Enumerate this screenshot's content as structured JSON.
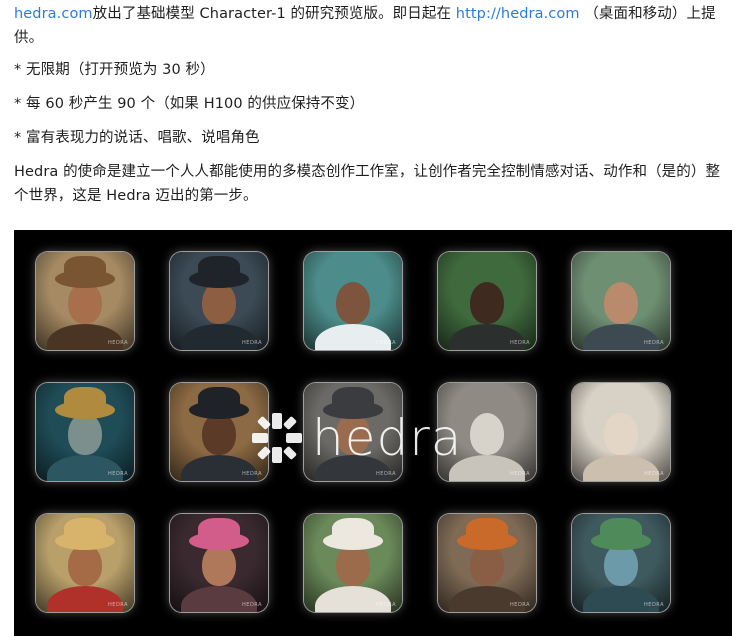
{
  "article": {
    "p1": {
      "link1": "hedra.com",
      "text1": "放出了基础模型 Character-1 的研究预览版。即日起在 ",
      "link2": "http://hedra.com",
      "text2": " （桌面和移动）上提供。"
    },
    "bullets": [
      "* 无限期（打开预览为 30 秒）",
      "* 每 60 秒产生 90 个（如果 H100 的供应保持不变）",
      "* 富有表现力的说话、唱歌、说唱角色"
    ],
    "p2": "Hedra 的使命是建立一个人人都能使用的多模态创作工作室，让创作者完全控制情感对话、动作和（是的）整个世界，这是 Hedra 迈出的第一步。"
  },
  "media": {
    "logo_text": "hedra",
    "tile_tag": "HEDRA",
    "tiles": [
      {
        "name": "cowboy-portrait",
        "bg": "#a58a63",
        "skin": "#a86f4c",
        "cloth": "#4a3424",
        "hat": true,
        "hatColor": "#7a5534"
      },
      {
        "name": "cap-man-portrait",
        "bg": "#3b4a55",
        "skin": "#8d5e42",
        "cloth": "#222a31",
        "hat": true,
        "hatColor": "#1e2429"
      },
      {
        "name": "water-splash-portrait",
        "bg": "#4c8c8a",
        "skin": "#7d543d",
        "cloth": "#e7eef0",
        "hat": false,
        "hatColor": ""
      },
      {
        "name": "green-backdrop-portrait",
        "bg": "#3f6a3d",
        "skin": "#3f2a20",
        "cloth": "#2b2f2d",
        "hat": false,
        "hatColor": ""
      },
      {
        "name": "mountain-man-portrait",
        "bg": "#6f8f73",
        "skin": "#b98a6c",
        "cloth": "#3e4a52",
        "hat": false,
        "hatColor": ""
      },
      {
        "name": "sea-god-portrait",
        "bg": "#1f4c57",
        "skin": "#7c8f8c",
        "cloth": "#2d5663",
        "hat": true,
        "hatColor": "#b08a3e"
      },
      {
        "name": "officer-portrait",
        "bg": "#8c6a44",
        "skin": "#5c3a28",
        "cloth": "#2a2f35",
        "hat": true,
        "hatColor": "#1f2327"
      },
      {
        "name": "pilot-portrait",
        "bg": "#6b6a66",
        "skin": "#9a6c4f",
        "cloth": "#33363a",
        "hat": true,
        "hatColor": "#3a3c40"
      },
      {
        "name": "statue-portrait",
        "bg": "#8f8b84",
        "skin": "#d7d3cb",
        "cloth": "#c9c4bb",
        "hat": false,
        "hatColor": ""
      },
      {
        "name": "sketch-woman-portrait",
        "bg": "#d8d2c6",
        "skin": "#e4d6c6",
        "cloth": "#cdbfae",
        "hat": false,
        "hatColor": ""
      },
      {
        "name": "flower-hat-woman-portrait",
        "bg": "#b9a06b",
        "skin": "#a56a46",
        "cloth": "#b0302a",
        "hat": true,
        "hatColor": "#d8b36a"
      },
      {
        "name": "flower-crown-woman-portrait",
        "bg": "#3a2a2f",
        "skin": "#b0785a",
        "cloth": "#5a3b3f",
        "hat": true,
        "hatColor": "#d35d8a"
      },
      {
        "name": "headscarf-man-portrait",
        "bg": "#6b8a5a",
        "skin": "#9c6b4c",
        "cloth": "#e5e1d8",
        "hat": true,
        "hatColor": "#ece8e0"
      },
      {
        "name": "warrior-woman-portrait",
        "bg": "#7e6a55",
        "skin": "#8a5e45",
        "cloth": "#4a3a2e",
        "hat": true,
        "hatColor": "#c96a2a"
      },
      {
        "name": "elf-portrait",
        "bg": "#3f5a5f",
        "skin": "#6d9aa8",
        "cloth": "#2e4a52",
        "hat": true,
        "hatColor": "#4e8a5a"
      }
    ]
  }
}
